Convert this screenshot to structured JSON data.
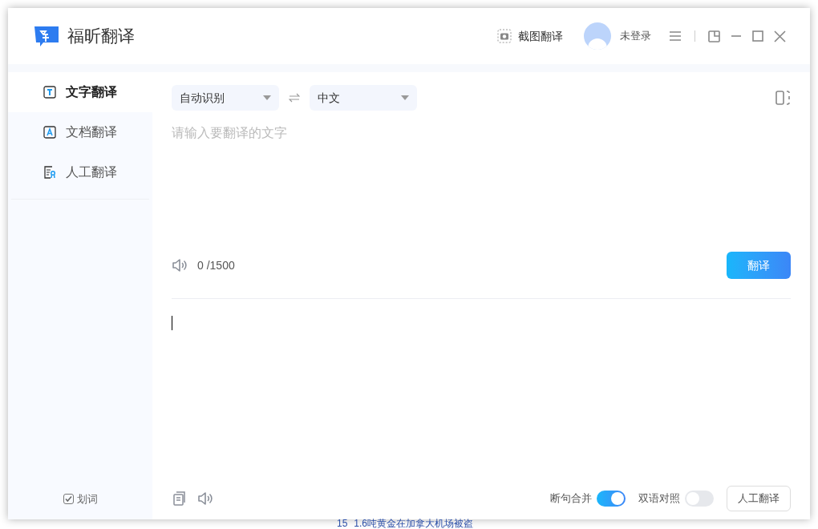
{
  "app": {
    "title": "福昕翻译"
  },
  "header": {
    "screenshot_translate": "截图翻译",
    "user": "未登录"
  },
  "sidebar": {
    "items": [
      {
        "label": "文字翻译",
        "kind": "text",
        "selected": true
      },
      {
        "label": "文档翻译",
        "kind": "document",
        "selected": false
      },
      {
        "label": "人工翻译",
        "kind": "human",
        "selected": false
      }
    ],
    "word_pick": {
      "label": "划词",
      "checked": true
    }
  },
  "languages": {
    "source": "自动识别",
    "target": "中文"
  },
  "input": {
    "placeholder": "请输入要翻译的文字",
    "counter": "0 /1500",
    "button": "翻译"
  },
  "footer": {
    "toggles": [
      {
        "label": "断句合并",
        "on": true
      },
      {
        "label": "双语对照",
        "on": false
      }
    ],
    "button": "人工翻译"
  },
  "background_page": {
    "headline_number": "15",
    "headline": "1.6吨黄金在加拿大机场被盗"
  }
}
